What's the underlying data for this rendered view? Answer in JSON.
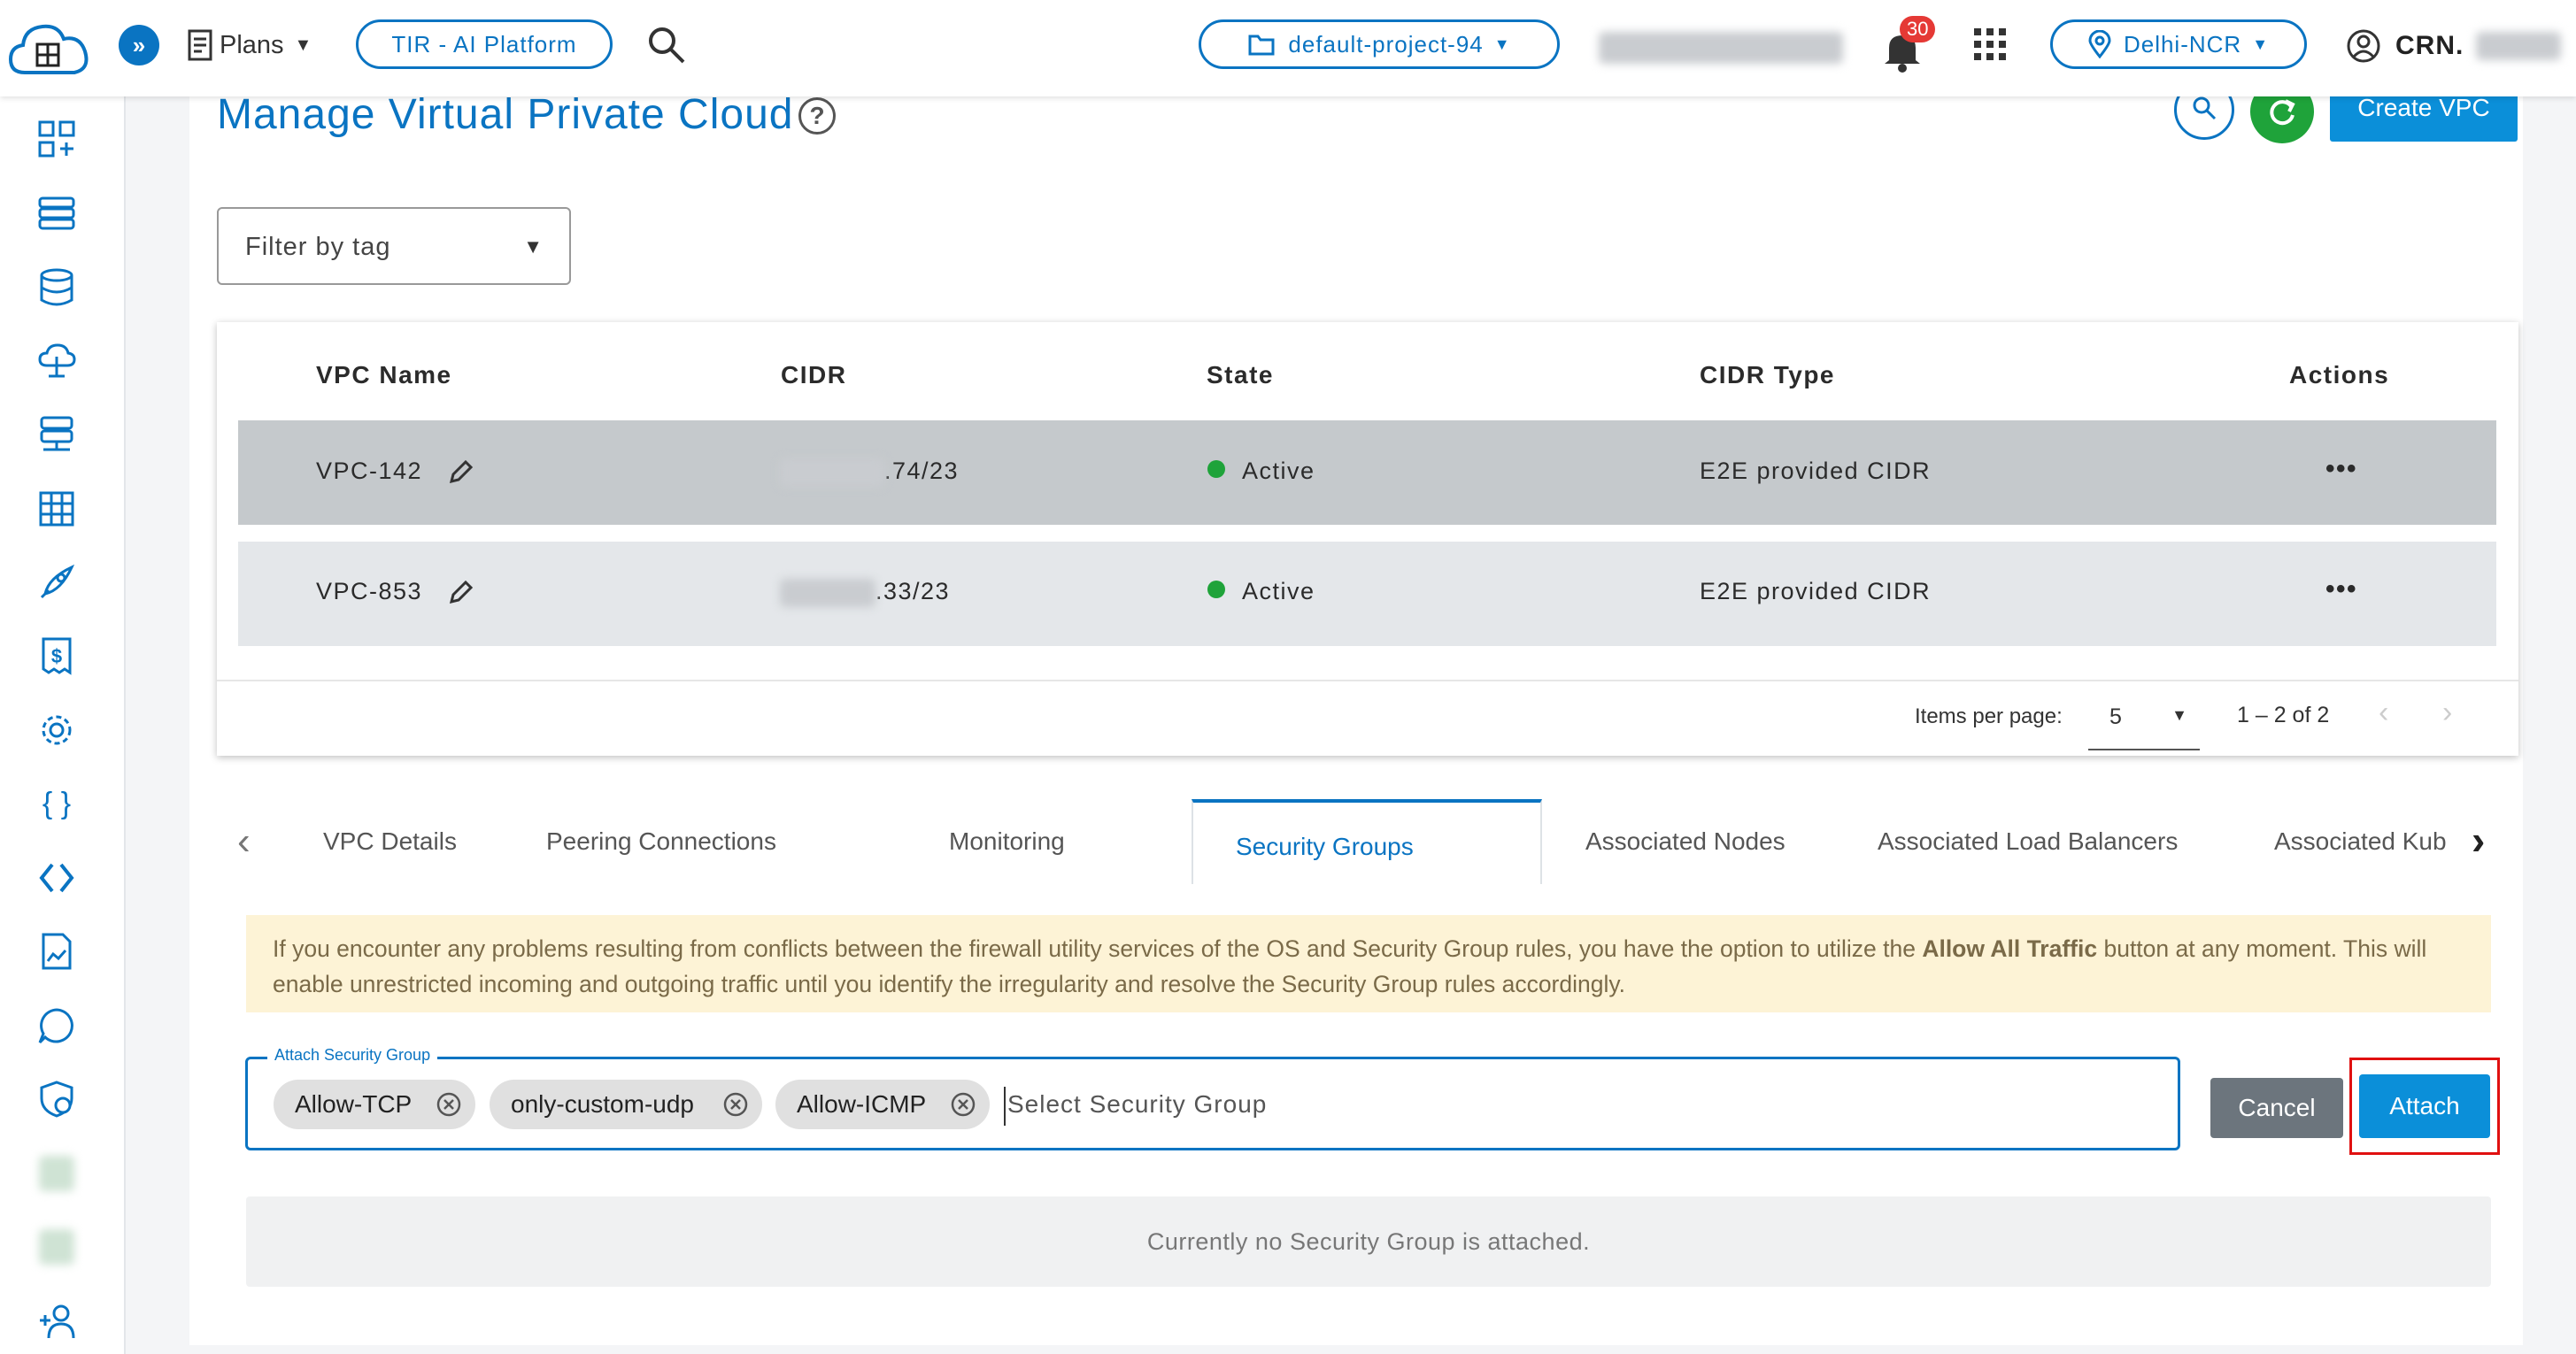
{
  "header": {
    "plans_label": "Plans",
    "platform_button": "TIR - AI Platform",
    "project_selector": "default-project-94",
    "notification_count": "30",
    "region_selector": "Delhi-NCR",
    "user_label": "CRN."
  },
  "page": {
    "title": "Manage Virtual Private Cloud",
    "create_button": "Create VPC",
    "filter_placeholder": "Filter by tag"
  },
  "table": {
    "columns": [
      "VPC Name",
      "CIDR",
      "State",
      "CIDR Type",
      "Actions"
    ],
    "rows": [
      {
        "name": "VPC-142",
        "cidr_suffix": ".74/23",
        "state": "Active",
        "cidr_type": "E2E provided CIDR",
        "actions": "•••"
      },
      {
        "name": "VPC-853",
        "cidr_suffix": ".33/23",
        "state": "Active",
        "cidr_type": "E2E provided CIDR",
        "actions": "•••"
      }
    ],
    "paginator": {
      "items_per_page_label": "Items per page:",
      "page_size": "5",
      "range_label": "1 – 2 of 2"
    }
  },
  "tabs": [
    "VPC Details",
    "Peering Connections",
    "Monitoring",
    "Security Groups",
    "Associated Nodes",
    "Associated Load Balancers",
    "Associated Kub"
  ],
  "active_tab": "Security Groups",
  "notice": {
    "text_before": "If you encounter any problems resulting from conflicts between the firewall utility services of the OS and Security Group rules, you have the option to utilize the ",
    "bold": "Allow All Traffic",
    "text_after": " button at any moment. This will enable unrestricted incoming and outgoing traffic until you identify the irregularity and resolve the Security Group rules accordingly."
  },
  "attach": {
    "field_label": "Attach Security Group",
    "chips": [
      "Allow-TCP",
      "only-custom-udp",
      "Allow-ICMP"
    ],
    "placeholder": "Select Security Group",
    "cancel_button": "Cancel",
    "attach_button": "Attach"
  },
  "empty_state": "Currently no Security Group is attached.",
  "colors": {
    "primary": "#0a74c2",
    "attach_button": "#0b8fd9",
    "highlight_box": "#e01010",
    "notice_bg": "#fdf3d6",
    "status_active": "#1fa33a"
  }
}
